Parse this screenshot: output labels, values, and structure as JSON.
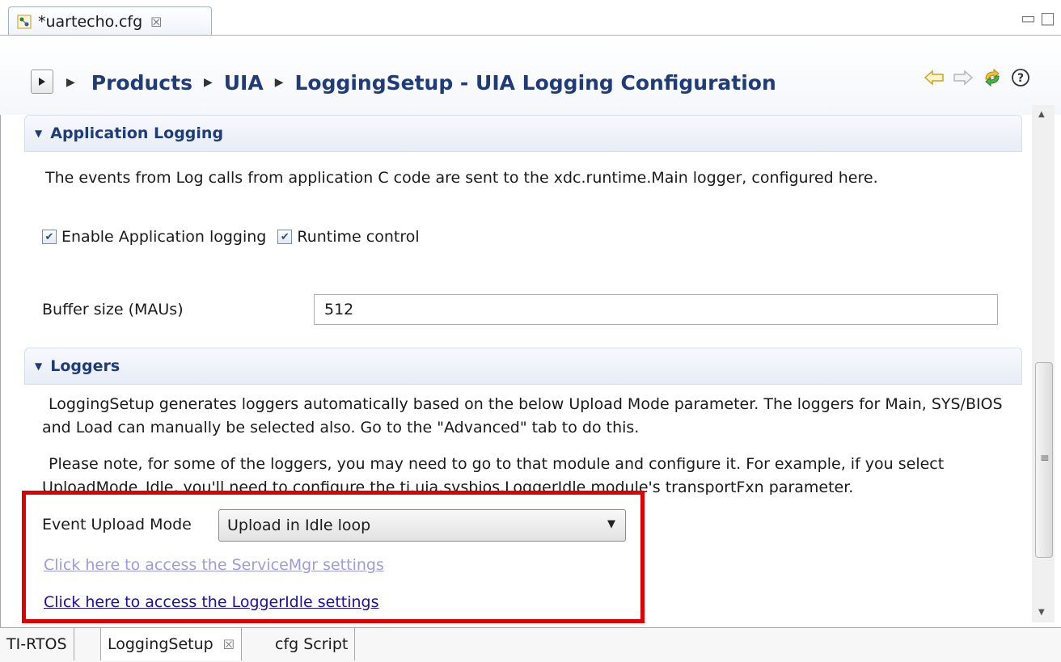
{
  "editor_tab": {
    "title": "*uartecho.cfg",
    "icon": "config-file-icon",
    "close_glyph": "☒"
  },
  "window_controls": {
    "minimize_glyph": "▭",
    "maximize_glyph": "□"
  },
  "breadcrumb": {
    "items": [
      "Products",
      "UIA",
      "LoggingSetup - UIA Logging Configuration"
    ]
  },
  "toolbar": {
    "back_icon": "back-arrow-icon",
    "forward_icon": "forward-arrow-icon",
    "sync_icon": "sync-icon",
    "help_icon": "help-icon"
  },
  "application_logging": {
    "header": "Application Logging",
    "description": "The events from Log calls from application C code are sent to the xdc.runtime.Main logger, configured here.",
    "enable_label": "Enable Application logging",
    "enable_checked": true,
    "runtime_label": "Runtime control",
    "runtime_checked": true,
    "buffer_label": "Buffer size (MAUs)",
    "buffer_value": "512"
  },
  "loggers": {
    "header": "Loggers",
    "description_1": "LoggingSetup generates loggers automatically based on the below Upload Mode parameter. The loggers for Main, SYS/BIOS and Load can manually be selected also. Go to the \"Advanced\" tab to do this.",
    "description_2": "Please note, for some of the loggers, you may need to go to that module and configure it. For example, if you select UploadMode_Idle, you'll need to configure the ti.uia.sysbios.LoggerIdle module's transportFxn parameter.",
    "upload_mode_label": "Event Upload Mode",
    "upload_mode_value": "Upload in Idle loop",
    "servicemgr_link": "Click here to access the ServiceMgr settings",
    "loggeridle_link": "Click here to access the LoggerIdle settings"
  },
  "bottom_tabs": [
    {
      "label": "TI-RTOS",
      "active": false
    },
    {
      "label": "LoggingSetup",
      "active": true,
      "close_glyph": "☒"
    },
    {
      "label": "cfg Script",
      "active": false
    }
  ],
  "colors": {
    "header_text": "#1f3c78",
    "highlight_border": "#e00000",
    "link_active": "#1a0dab",
    "link_disabled": "#9c9be0"
  }
}
